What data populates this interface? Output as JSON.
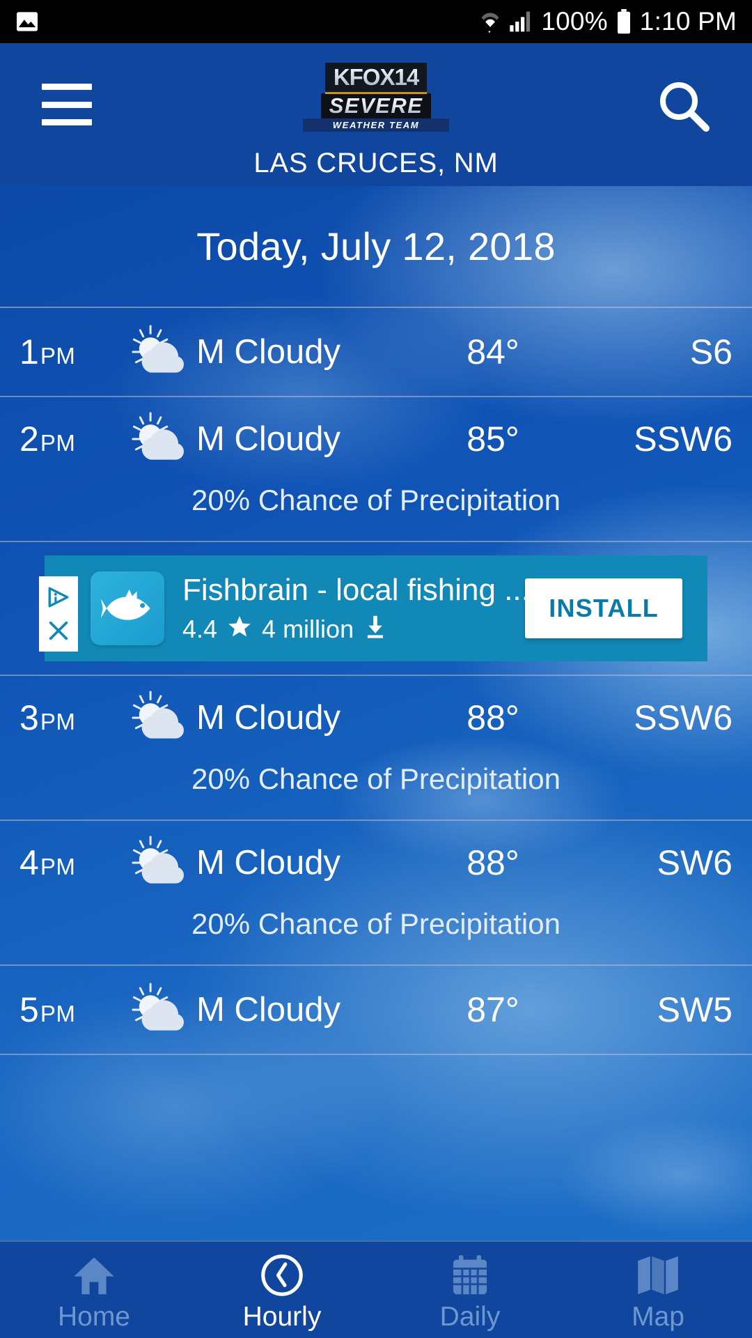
{
  "status_bar": {
    "left_icon": "image-icon",
    "wifi_icon": "wifi-icon",
    "signal_icon": "cell-signal-icon",
    "battery_percent": "100%",
    "battery_icon": "battery-full-icon",
    "time": "1:10 PM"
  },
  "header": {
    "menu_icon": "hamburger-menu-icon",
    "search_icon": "search-icon",
    "logo": {
      "line1": "KFOX14",
      "line2": "SEVERE",
      "line3": "WEATHER TEAM"
    },
    "location": "LAS CRUCES, NM"
  },
  "main": {
    "date_heading": "Today, July 12, 2018",
    "hours": [
      {
        "time": "1",
        "meridiem": "PM",
        "icon": "partly-cloudy-icon",
        "condition": "M Cloudy",
        "temperature": "84°",
        "wind": "S6",
        "precip": null
      },
      {
        "time": "2",
        "meridiem": "PM",
        "icon": "partly-cloudy-icon",
        "condition": "M Cloudy",
        "temperature": "85°",
        "wind": "SSW6",
        "precip": "20% Chance of Precipitation"
      },
      {
        "time": "3",
        "meridiem": "PM",
        "icon": "partly-cloudy-icon",
        "condition": "M Cloudy",
        "temperature": "88°",
        "wind": "SSW6",
        "precip": "20% Chance of Precipitation"
      },
      {
        "time": "4",
        "meridiem": "PM",
        "icon": "partly-cloudy-icon",
        "condition": "M Cloudy",
        "temperature": "88°",
        "wind": "SW6",
        "precip": "20% Chance of Precipitation"
      },
      {
        "time": "5",
        "meridiem": "PM",
        "icon": "partly-cloudy-icon",
        "condition": "M Cloudy",
        "temperature": "87°",
        "wind": "SW5",
        "precip": null
      }
    ]
  },
  "ad": {
    "adchoices_icon": "adchoices-icon",
    "close_icon": "close-icon",
    "app_icon": "fish-icon",
    "title": "Fishbrain - local fishing ...",
    "rating": "4.4",
    "star_icon": "star-icon",
    "downloads": "4 million",
    "download_icon": "download-icon",
    "install_label": "INSTALL"
  },
  "bottom_nav": [
    {
      "label": "Home",
      "icon": "home-icon",
      "active": false
    },
    {
      "label": "Hourly",
      "icon": "clock-icon",
      "active": true
    },
    {
      "label": "Daily",
      "icon": "calendar-icon",
      "active": false
    },
    {
      "label": "Map",
      "icon": "map-icon",
      "active": false
    }
  ],
  "colors": {
    "header_blue": "#10469e",
    "sky_blue": "#0f52b4",
    "ad_teal": "#1188b6",
    "install_text": "#0a7aa8",
    "nav_inactive": "#6f97cf"
  }
}
